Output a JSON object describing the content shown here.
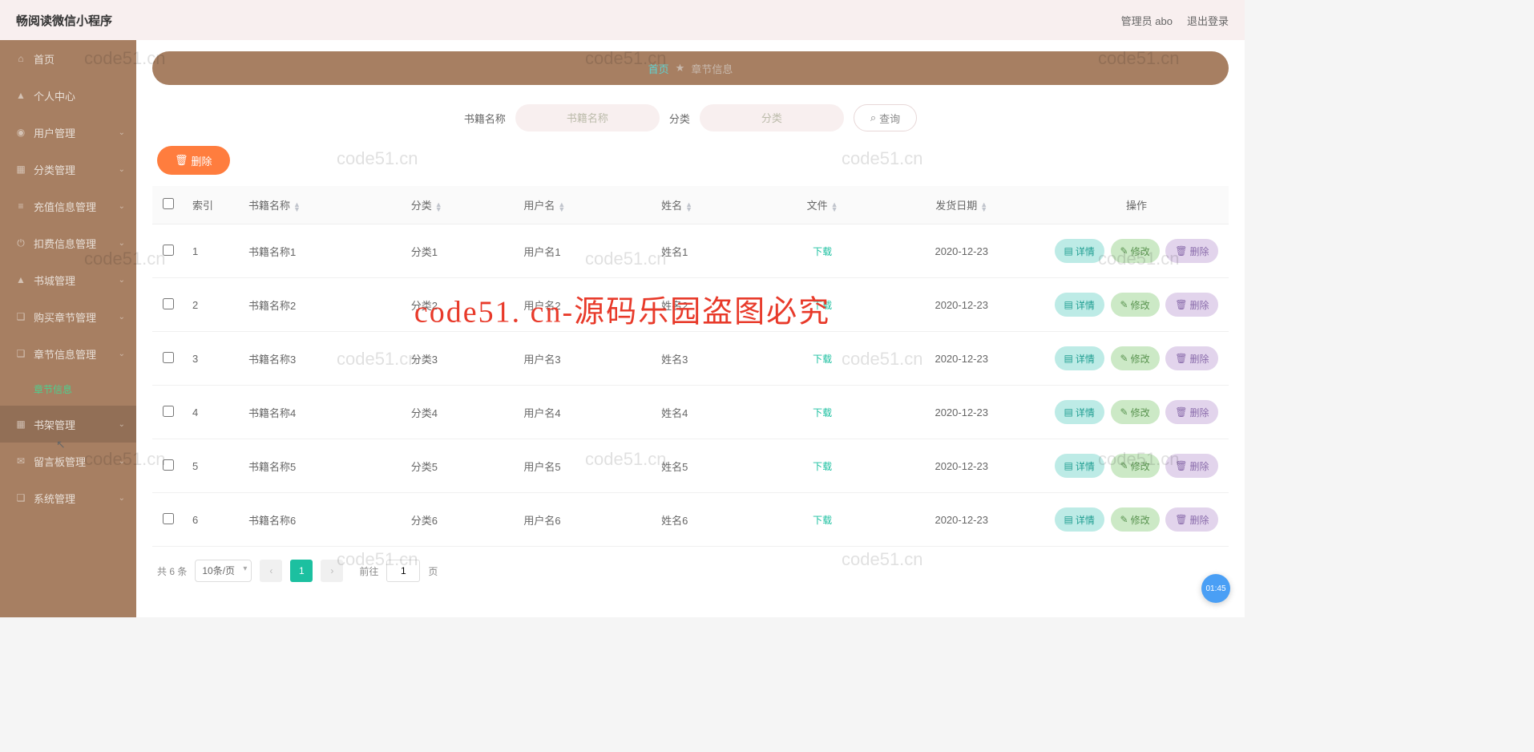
{
  "header": {
    "logo": "畅阅读微信小程序",
    "admin_label": "管理员 abo",
    "logout": "退出登录"
  },
  "sidebar": {
    "items": [
      {
        "icon": "⌂",
        "label": "首页",
        "chev": false
      },
      {
        "icon": "▲",
        "label": "个人中心",
        "chev": false
      },
      {
        "icon": "◉",
        "label": "用户管理",
        "chev": true
      },
      {
        "icon": "▦",
        "label": "分类管理",
        "chev": true
      },
      {
        "icon": "≡",
        "label": "充值信息管理",
        "chev": true
      },
      {
        "icon": "⏻",
        "label": "扣费信息管理",
        "chev": true
      },
      {
        "icon": "▲",
        "label": "书城管理",
        "chev": true
      },
      {
        "icon": "❑",
        "label": "购买章节管理",
        "chev": true
      },
      {
        "icon": "❑",
        "label": "章节信息管理",
        "chev": true
      },
      {
        "icon": "▦",
        "label": "书架管理",
        "chev": true,
        "hovered": true
      },
      {
        "icon": "✉",
        "label": "留言板管理",
        "chev": true
      },
      {
        "icon": "❑",
        "label": "系统管理",
        "chev": true
      }
    ],
    "sub_label": "章节信息"
  },
  "breadcrumb": {
    "home": "首页",
    "current": "章节信息"
  },
  "search": {
    "label_book": "书籍名称",
    "placeholder_book": "书籍名称",
    "label_cat": "分类",
    "placeholder_cat": "分类",
    "query_btn": "查询"
  },
  "top_delete": "删除",
  "table": {
    "headers": {
      "index": "索引",
      "book": "书籍名称",
      "cat": "分类",
      "user": "用户名",
      "name": "姓名",
      "file": "文件",
      "date": "发货日期",
      "action": "操作"
    },
    "file_link": "下载",
    "actions": {
      "detail": "详情",
      "edit": "修改",
      "del": "删除"
    },
    "rows": [
      {
        "idx": "1",
        "book": "书籍名称1",
        "cat": "分类1",
        "user": "用户名1",
        "name": "姓名1",
        "date": "2020-12-23"
      },
      {
        "idx": "2",
        "book": "书籍名称2",
        "cat": "分类2",
        "user": "用户名2",
        "name": "姓名2",
        "date": "2020-12-23"
      },
      {
        "idx": "3",
        "book": "书籍名称3",
        "cat": "分类3",
        "user": "用户名3",
        "name": "姓名3",
        "date": "2020-12-23"
      },
      {
        "idx": "4",
        "book": "书籍名称4",
        "cat": "分类4",
        "user": "用户名4",
        "name": "姓名4",
        "date": "2020-12-23"
      },
      {
        "idx": "5",
        "book": "书籍名称5",
        "cat": "分类5",
        "user": "用户名5",
        "name": "姓名5",
        "date": "2020-12-23"
      },
      {
        "idx": "6",
        "book": "书籍名称6",
        "cat": "分类6",
        "user": "用户名6",
        "name": "姓名6",
        "date": "2020-12-23"
      }
    ]
  },
  "pagination": {
    "total": "共 6 条",
    "page_size": "10条/页",
    "current": "1",
    "goto_prefix": "前往",
    "goto_suffix": "页",
    "goto_value": "1"
  },
  "watermark_text": "code51.cn",
  "watermark_big": "code51. cn-源码乐园盗图必究",
  "time_badge": "01:45"
}
